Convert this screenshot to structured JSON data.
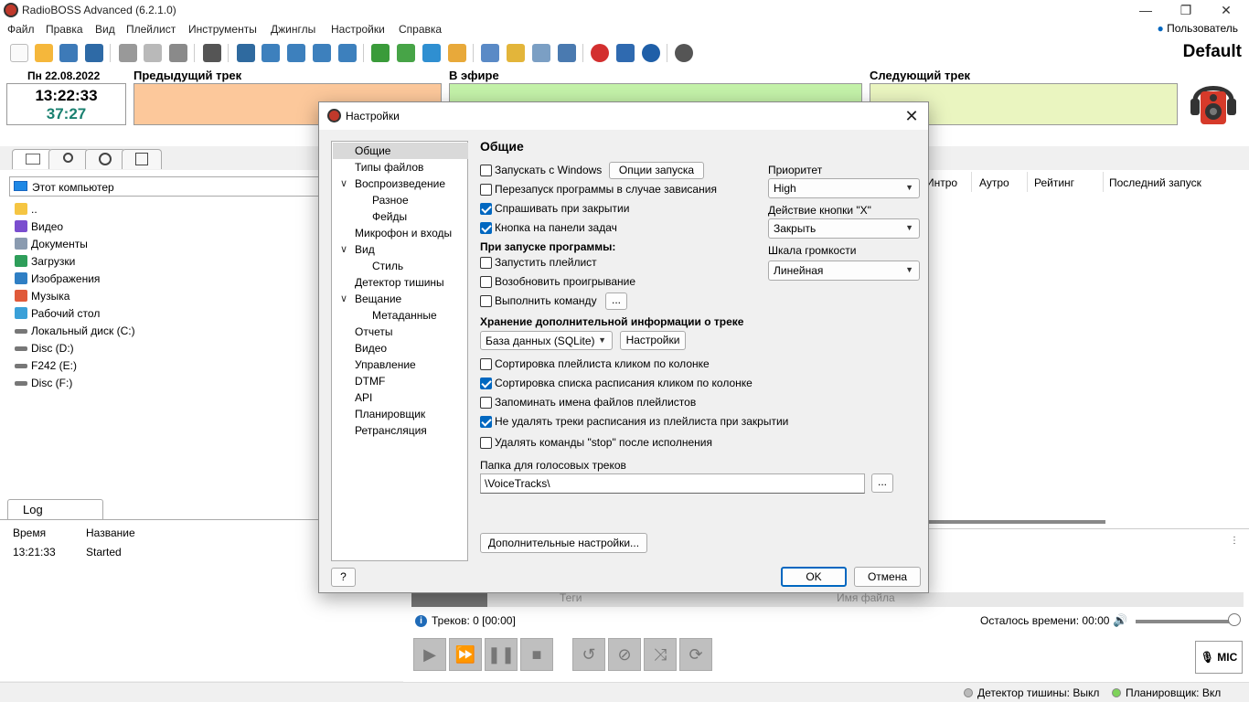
{
  "app": {
    "title": "RadioBOSS Advanced (6.2.1.0)",
    "user": "Пользователь",
    "profile": "Default"
  },
  "window_controls": {
    "minimize": "—",
    "maximize": "❐",
    "close": "✕"
  },
  "menu": [
    "Файл",
    "Правка",
    "Вид",
    "Плейлист",
    "Инструменты",
    "Джинглы",
    "Настройки",
    "Справка"
  ],
  "clock": {
    "date": "Пн 22.08.2022",
    "time": "13:22:33",
    "remaining": "37:27"
  },
  "tracks": {
    "previous": "Предыдущий трек",
    "on_air": "В эфире",
    "next": "Следующий трек"
  },
  "colors": {
    "previous": "#fcc89b",
    "on_air": "#c4f2a9",
    "next": "#eaf5c0",
    "accent": "#0067c0"
  },
  "browser": {
    "path": "Этот компьютер",
    "items": [
      {
        "label": "..",
        "icon": "folder-icon"
      },
      {
        "label": "Видео",
        "icon": "video-folder-icon"
      },
      {
        "label": "Документы",
        "icon": "documents-folder-icon"
      },
      {
        "label": "Загрузки",
        "icon": "downloads-folder-icon"
      },
      {
        "label": "Изображения",
        "icon": "pictures-folder-icon"
      },
      {
        "label": "Музыка",
        "icon": "music-folder-icon"
      },
      {
        "label": "Рабочий стол",
        "icon": "desktop-folder-icon"
      },
      {
        "label": "Локальный диск (C:)",
        "icon": "drive-icon"
      },
      {
        "label": "Disc (D:)",
        "icon": "drive-icon"
      },
      {
        "label": "F242 (E:)",
        "icon": "drive-icon"
      },
      {
        "label": "Disc (F:)",
        "icon": "drive-icon"
      }
    ]
  },
  "log": {
    "tab": "Log",
    "col_time": "Время",
    "col_name": "Название",
    "rows": [
      {
        "time": "13:21:33",
        "name": "Started"
      }
    ]
  },
  "playlist": {
    "columns": [
      "Интро",
      "Аутро",
      "Рейтинг",
      "Последний запуск"
    ],
    "sub_columns": [
      "Теги",
      "Имя файла"
    ],
    "tracks_info": "Треков: 0 [00:00]",
    "remaining": "Осталось времени: 00:00",
    "volume": 1.0,
    "mic_label": "MIC"
  },
  "statusbar": {
    "silence": "Детектор тишины: Выкл",
    "scheduler": "Планировщик: Вкл"
  },
  "dialog": {
    "title": "Настройки",
    "nav": [
      {
        "label": "Общие",
        "level": 0,
        "selected": true
      },
      {
        "label": "Типы файлов",
        "level": 0
      },
      {
        "label": "Воспроизведение",
        "level": 0,
        "expanded": true
      },
      {
        "label": "Разное",
        "level": 1
      },
      {
        "label": "Фейды",
        "level": 1
      },
      {
        "label": "Микрофон и входы",
        "level": 0
      },
      {
        "label": "Вид",
        "level": 0,
        "expanded": true
      },
      {
        "label": "Стиль",
        "level": 1
      },
      {
        "label": "Детектор тишины",
        "level": 0
      },
      {
        "label": "Вещание",
        "level": 0,
        "expanded": true
      },
      {
        "label": "Метаданные",
        "level": 1
      },
      {
        "label": "Отчеты",
        "level": 0
      },
      {
        "label": "Видео",
        "level": 0
      },
      {
        "label": "Управление",
        "level": 0
      },
      {
        "label": "DTMF",
        "level": 0
      },
      {
        "label": "API",
        "level": 0
      },
      {
        "label": "Планировщик",
        "level": 0
      },
      {
        "label": "Ретрансляция",
        "level": 0
      }
    ],
    "section_title": "Общие",
    "startup_windows": {
      "label": "Запускать с Windows",
      "checked": false
    },
    "startup_options_button": "Опции запуска",
    "restart_on_hang": {
      "label": "Перезапуск программы в случае зависания",
      "checked": false
    },
    "ask_on_close": {
      "label": "Спрашивать при закрытии",
      "checked": true
    },
    "taskbar_button": {
      "label": "Кнопка на панели задач",
      "checked": true
    },
    "on_startup_title": "При запуске программы:",
    "start_playlist": {
      "label": "Запустить плейлист",
      "checked": false
    },
    "resume_playback": {
      "label": "Возобновить проигрывание",
      "checked": false
    },
    "run_command": {
      "label": "Выполнить команду",
      "checked": false
    },
    "ellipsis": "...",
    "storage_title": "Хранение дополнительной информации о треке",
    "storage_value": "База данных (SQLite)",
    "storage_settings_button": "Настройки",
    "sort_playlist": {
      "label": "Сортировка плейлиста кликом по колонке",
      "checked": false
    },
    "sort_schedule": {
      "label": "Сортировка списка расписания кликом по колонке",
      "checked": true
    },
    "remember_names": {
      "label": "Запоминать имена файлов плейлистов",
      "checked": false
    },
    "keep_schedule": {
      "label": "Не удалять треки расписания из плейлиста при закрытии",
      "checked": true
    },
    "remove_stop": {
      "label": "Удалять команды \"stop\" после исполнения",
      "checked": false
    },
    "voice_folder_label": "Папка для голосовых треков",
    "voice_folder_value": "\\VoiceTracks\\",
    "advanced_button": "Дополнительные настройки...",
    "priority_label": "Приоритет",
    "priority_value": "High",
    "x_action_label": "Действие кнопки \"X\"",
    "x_action_value": "Закрыть",
    "volume_scale_label": "Шкала громкости",
    "volume_scale_value": "Линейная",
    "ok": "OK",
    "cancel": "Отмена",
    "help": "?"
  }
}
